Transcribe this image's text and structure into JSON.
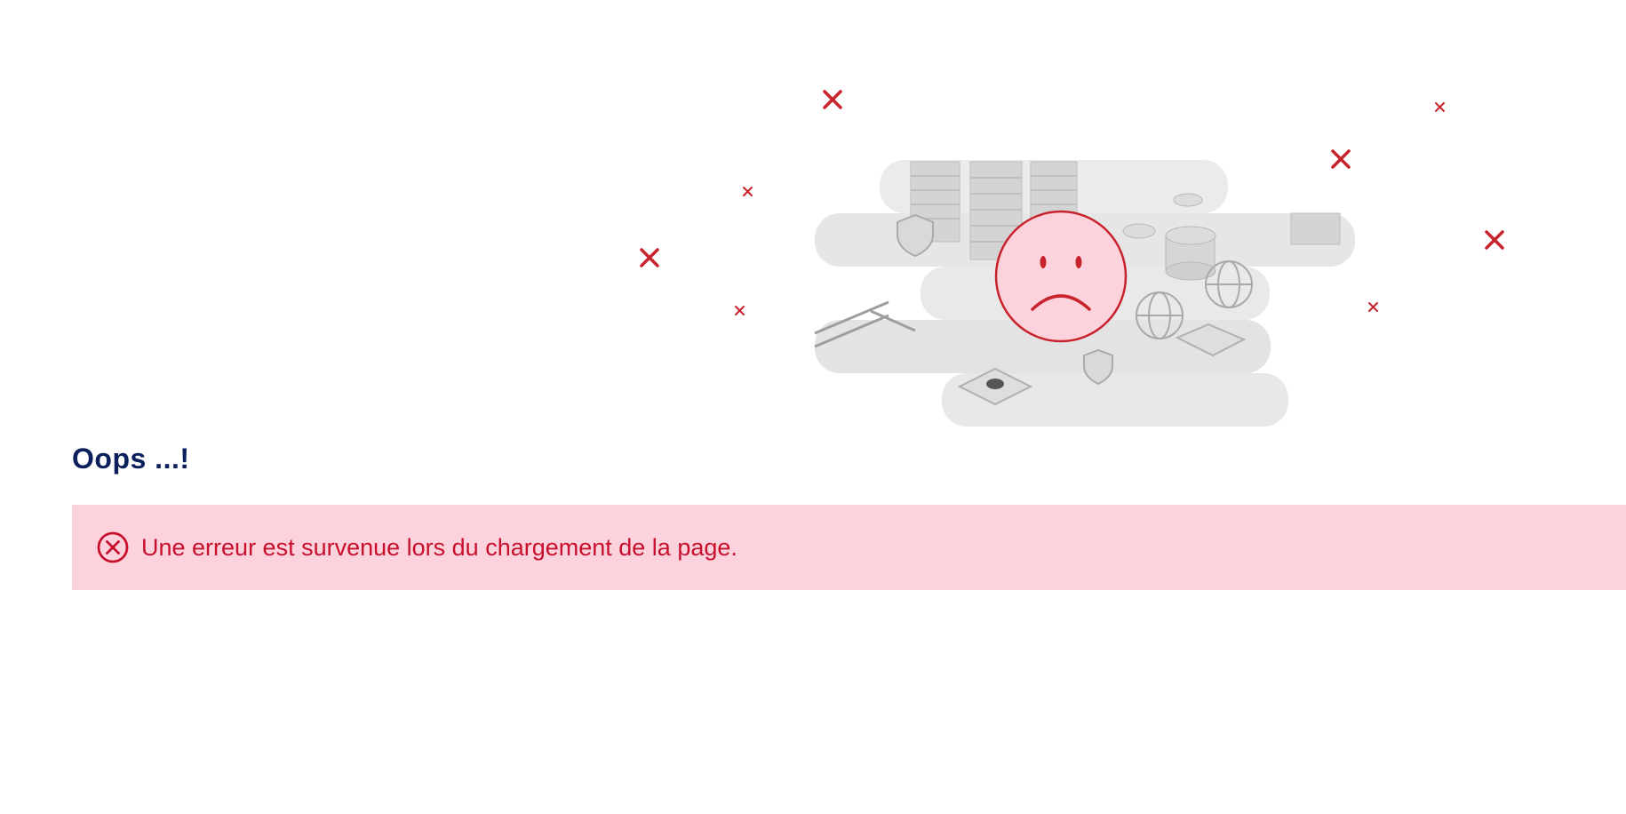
{
  "error": {
    "heading": "Oops ...!",
    "message": "Une erreur est survenue lors du chargement de la page."
  },
  "colors": {
    "heading": "#0a1f5c",
    "alert_background": "#fcd3dc",
    "alert_text": "#c8102e",
    "cross_marks": "#c8232c"
  },
  "icons": {
    "alert": "circle-x-icon",
    "illustration": "sad-face-icon"
  }
}
